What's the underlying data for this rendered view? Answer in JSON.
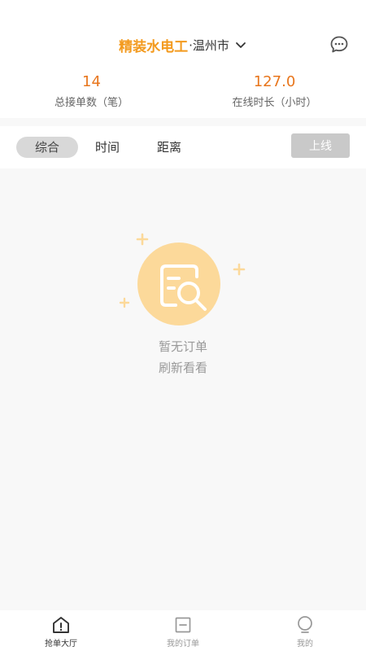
{
  "header": {
    "title": "精装水电工",
    "city": "·温州市",
    "message_icon": "chat-bubble-icon",
    "dropdown_icon": "chevron-down-icon"
  },
  "stats": [
    {
      "value": "14",
      "label": "总接单数（笔）"
    },
    {
      "value": "127.0",
      "label": "在线时长（小时）"
    }
  ],
  "filters": {
    "tabs": [
      "综合",
      "时间",
      "距离"
    ],
    "selected": "综合",
    "online_button": "上线"
  },
  "empty_state": {
    "line1": "暂无订单",
    "line2": "刷新看看",
    "icon": "document-search-icon"
  },
  "tabbar": {
    "items": [
      {
        "label": "抢单大厅",
        "icon": "home-info-icon",
        "active": true
      },
      {
        "label": "我的订单",
        "icon": "order-list-icon",
        "active": false
      },
      {
        "label": "我的",
        "icon": "profile-bulb-icon",
        "active": false
      }
    ]
  },
  "colors": {
    "brand": "#f39a1e",
    "stat_value": "#e8761d",
    "empty_circle": "#fcd99a"
  }
}
